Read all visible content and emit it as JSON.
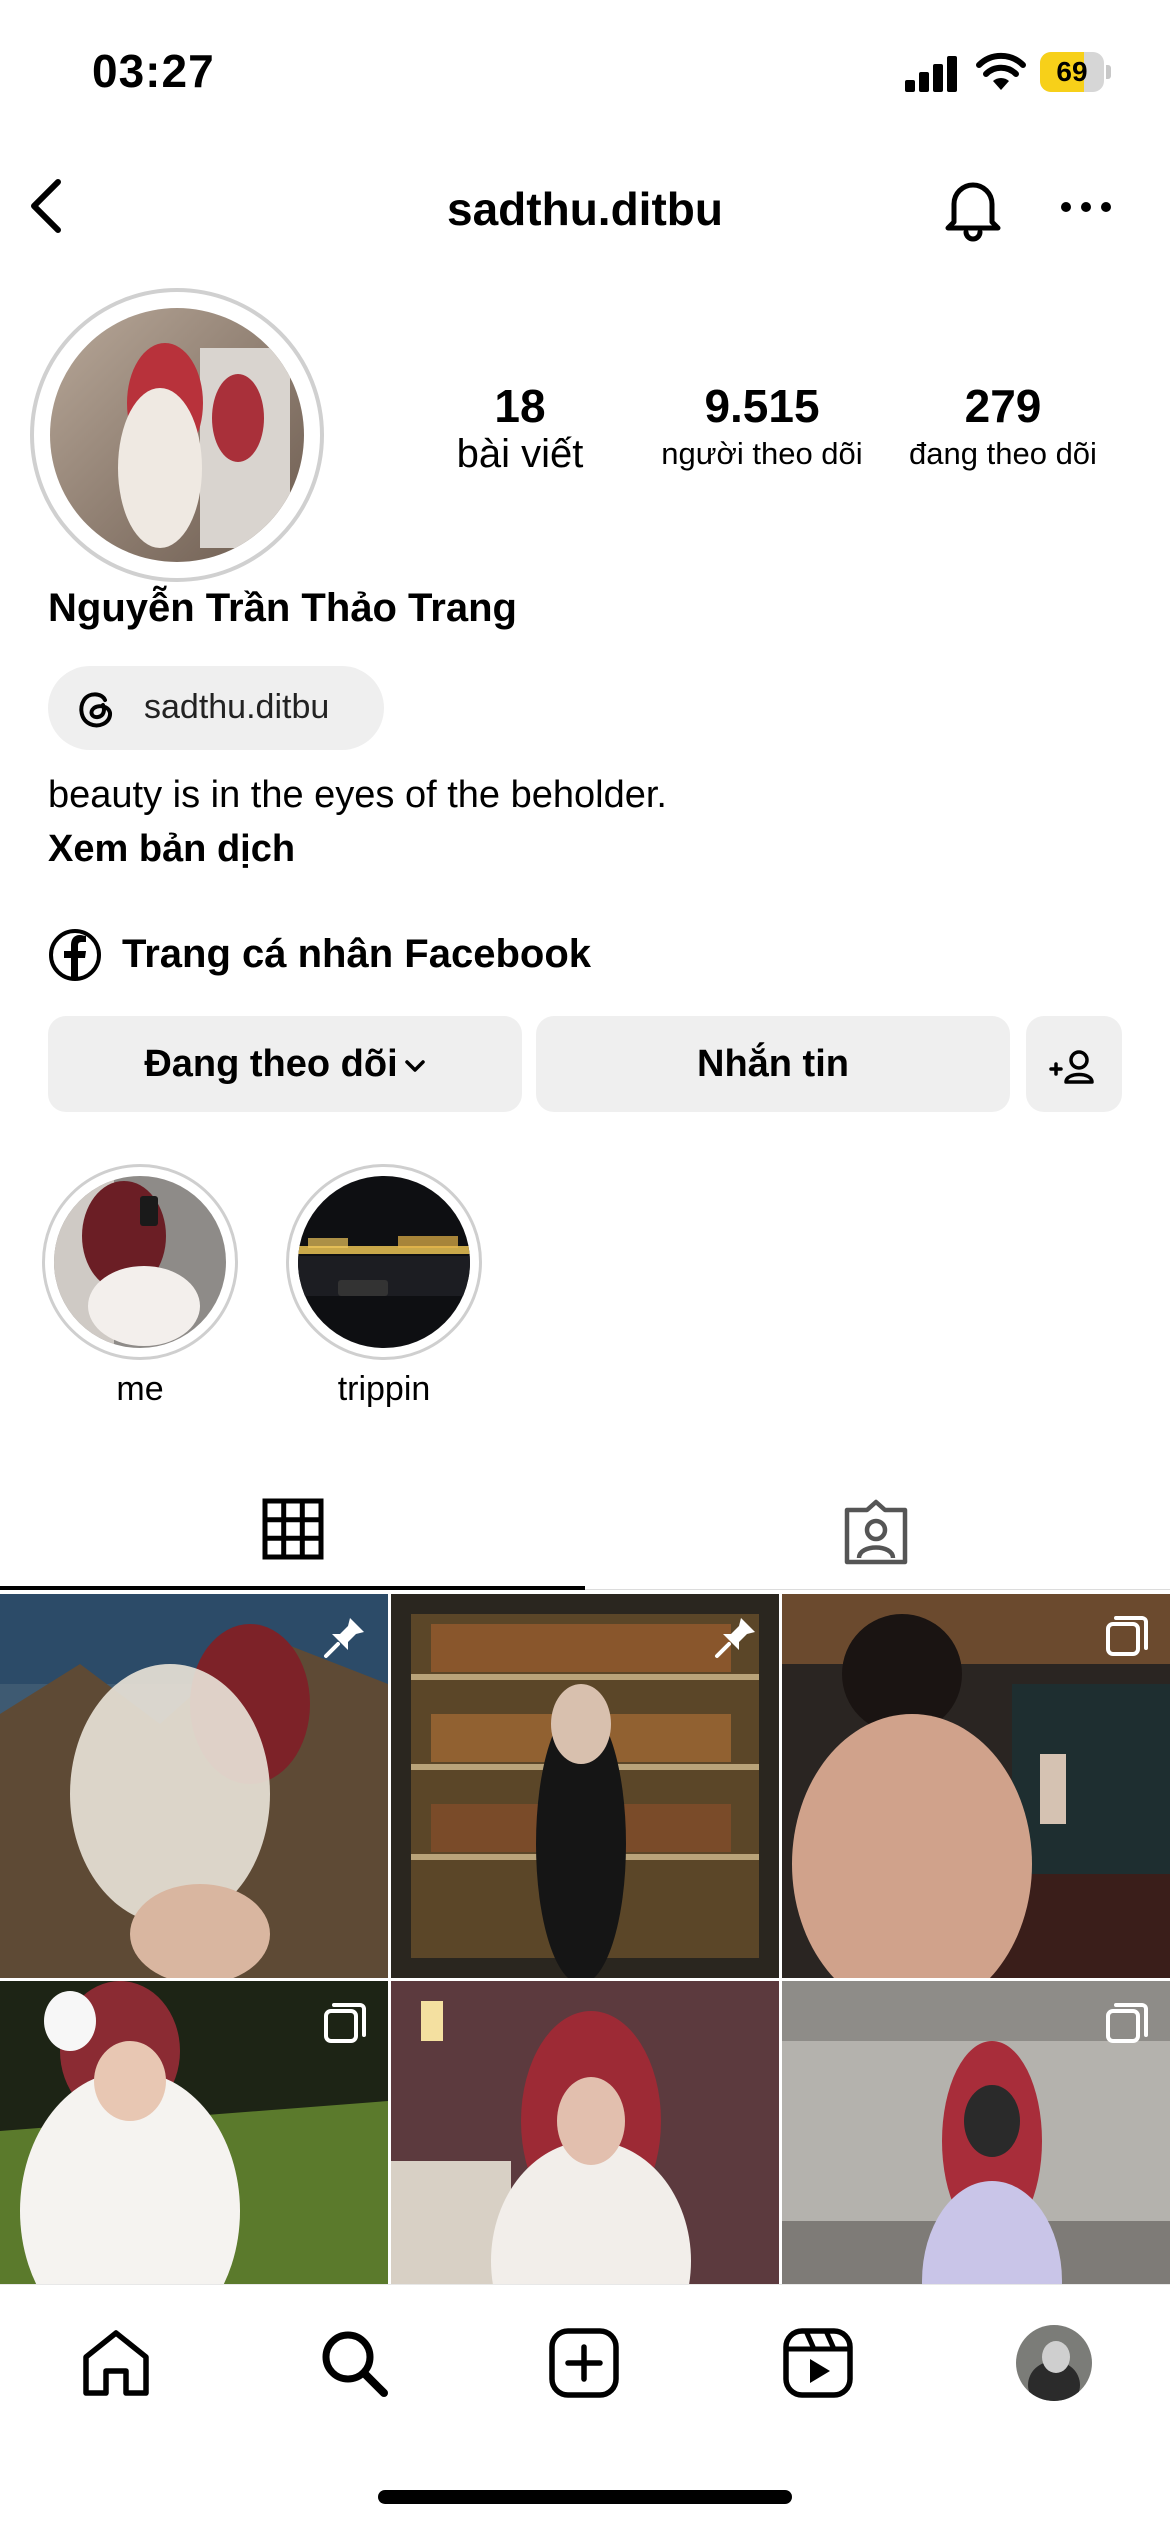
{
  "status_bar": {
    "time": "03:27",
    "battery_level": 69,
    "battery_text": "69"
  },
  "header": {
    "username": "sadthu.ditbu",
    "icons": {
      "back": "chevron-left-icon",
      "bell": "bell-icon",
      "more": "more-horizontal-icon"
    }
  },
  "profile": {
    "stats": [
      {
        "value": "18",
        "label": "bài viết"
      },
      {
        "value": "9.515",
        "label": "người theo dõi"
      },
      {
        "value": "279",
        "label": "đang theo dõi"
      }
    ],
    "full_name": "Nguyễn Trần Thảo Trang",
    "threads_handle": "sadthu.ditbu",
    "bio": "beauty is in the eyes of the beholder.",
    "translate_label": "Xem bản dịch",
    "facebook_link": "Trang cá nhân Facebook"
  },
  "actions": {
    "following_label": "Đang theo dõi",
    "message_label": "Nhắn tin",
    "add_user_icon": "add-user-icon"
  },
  "highlights": [
    {
      "label": "me"
    },
    {
      "label": "trippin"
    }
  ],
  "tabs": [
    {
      "icon": "grid-icon",
      "active": true
    },
    {
      "icon": "tagged-icon",
      "active": false
    }
  ],
  "posts": [
    {
      "badge": "pin-icon"
    },
    {
      "badge": "pin-icon"
    },
    {
      "badge": "carousel-icon"
    },
    {
      "badge": "carousel-icon"
    },
    {
      "badge": ""
    },
    {
      "badge": "carousel-icon"
    }
  ],
  "bottom_nav": [
    "home-icon",
    "search-icon",
    "create-icon",
    "reels-icon",
    "profile-avatar"
  ],
  "colors": {
    "battery": "#f7d019",
    "button_bg": "#efefef"
  }
}
